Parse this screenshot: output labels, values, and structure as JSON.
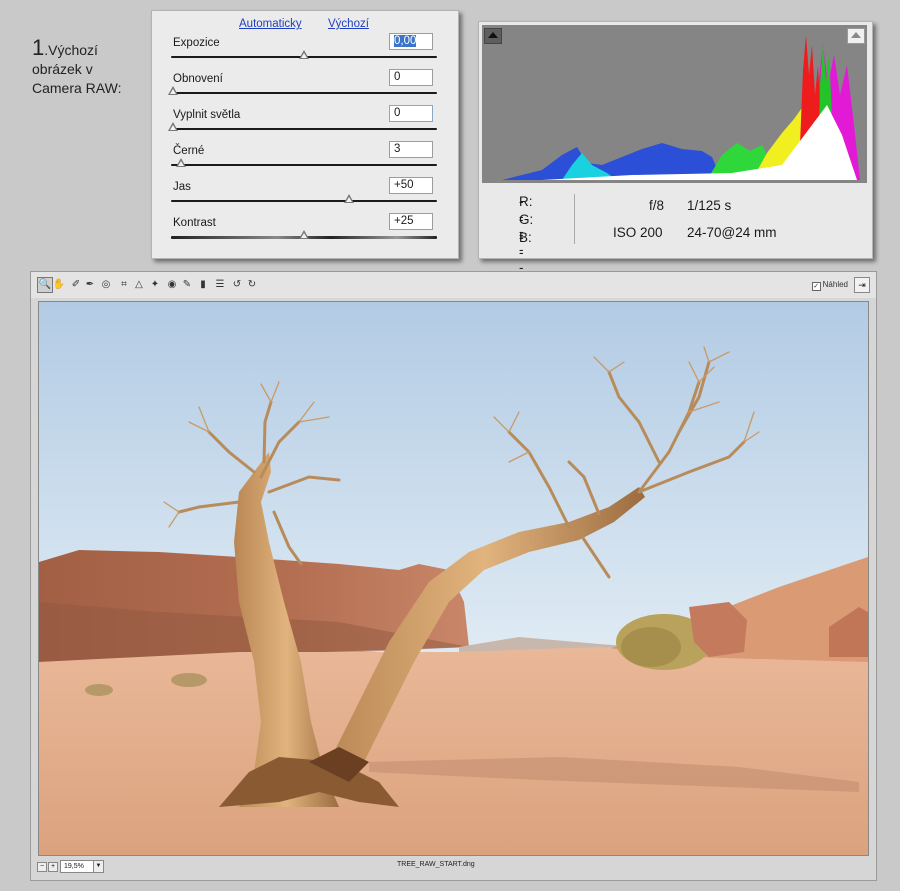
{
  "caption": {
    "number": "1",
    "line1": ".Výchozí",
    "line2": "obrázek v",
    "line3": "Camera RAW:"
  },
  "adjust": {
    "links": {
      "auto": "Automaticky",
      "default": "Výchozí"
    },
    "rows": [
      {
        "label": "Expozice",
        "value": "0,00",
        "level": 0.5
      },
      {
        "label": "Obnovení",
        "value": "0",
        "level": 0.0
      },
      {
        "label": "Vyplnit světla",
        "value": "0",
        "level": 0.0
      },
      {
        "label": "Černé",
        "value": "3",
        "level": 0.03
      },
      {
        "label": "Jas",
        "value": "+50",
        "level": 0.67
      },
      {
        "label": "Kontrast",
        "value": "+25",
        "level": 0.5
      }
    ]
  },
  "histogram": {
    "r_label": "R:",
    "r_value": "---",
    "g_label": "G:",
    "g_value": "---",
    "b_label": "B:",
    "b_value": "---",
    "aperture": "f/8",
    "shutter": "1/125 s",
    "iso": "ISO 200",
    "lens": "24-70@24 mm"
  },
  "editor": {
    "tools": [
      "zoom-tool",
      "hand-tool",
      "white-balance-tool",
      "color-sampler-tool",
      "target-adjustment-tool",
      "crop-tool",
      "straighten-tool",
      "retouch-tool",
      "red-eye-tool",
      "adjustment-brush-tool",
      "graduated-filter-tool",
      "preferences",
      "rotate-left",
      "rotate-right"
    ],
    "preview_label": "Náhled",
    "zoom_value": "19,5%",
    "filename": "TREE_RAW_START.dng"
  }
}
